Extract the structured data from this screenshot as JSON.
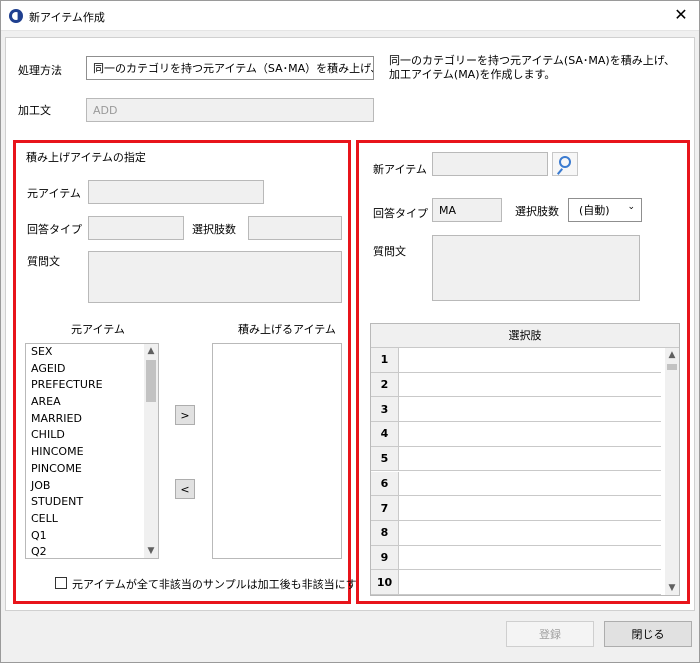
{
  "window": {
    "title": "新アイテム作成",
    "close_glyph": "✕"
  },
  "method": {
    "label": "処理方法",
    "value": "同一のカテゴリを持つ元アイテム（SA･MA）を積み上げ、MAアイテム",
    "description_lines": [
      "同一のカテゴリーを持つ元アイテム(SA･MA)を積み上げ、",
      "加工アイテム(MA)を作成します。"
    ]
  },
  "processed_text": {
    "label": "加工文",
    "value": "ADD"
  },
  "left_panel": {
    "title": "積み上げアイテムの指定",
    "source_item_label": "元アイテム",
    "answer_type_label": "回答タイプ",
    "choice_count_label": "選択肢数",
    "question_label": "質問文",
    "source_list_header": "元アイテム",
    "stack_list_header": "積み上げるアイテム",
    "source_items": [
      "SEX",
      "AGEID",
      "PREFECTURE",
      "AREA",
      "MARRIED",
      "CHILD",
      "HINCOME",
      "PINCOME",
      "JOB",
      "STUDENT",
      "CELL",
      "Q1",
      "Q2"
    ],
    "add_button": ">",
    "remove_button": "<",
    "checkbox_label": "元アイテムが全て非該当のサンプルは加工後も非該当にする"
  },
  "right_panel": {
    "new_item_label": "新アイテム",
    "answer_type_label": "回答タイプ",
    "answer_type_value": "MA",
    "choice_count_label": "選択肢数",
    "choice_count_value": "(自動)",
    "question_label": "質問文",
    "grid_header": "選択肢",
    "row_numbers": [
      "1",
      "2",
      "3",
      "4",
      "5",
      "6",
      "7",
      "8",
      "9",
      "10"
    ]
  },
  "footer": {
    "register_label": "登録",
    "close_label": "閉じる"
  },
  "colors": {
    "panel_border": "#e8141b"
  }
}
